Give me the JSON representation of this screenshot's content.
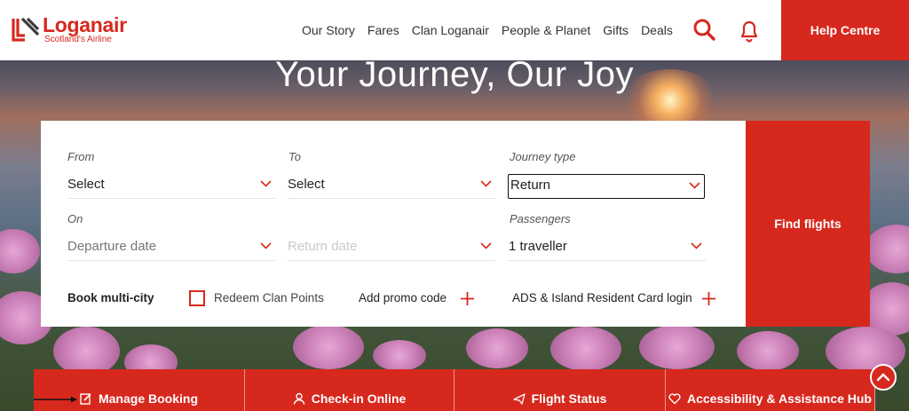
{
  "header": {
    "logo": {
      "name": "Loganair",
      "tagline": "Scotland's Airline"
    },
    "nav": [
      "Our Story",
      "Fares",
      "Clan Loganair",
      "People & Planet",
      "Gifts",
      "Deals"
    ],
    "help_label": "Help Centre"
  },
  "hero": {
    "title": "Your Journey, Our Joy"
  },
  "booking": {
    "from": {
      "label": "From",
      "value": "Select"
    },
    "to": {
      "label": "To",
      "value": "Select"
    },
    "journey_type": {
      "label": "Journey type",
      "value": "Return"
    },
    "on": {
      "label": "On",
      "departure_placeholder": "Departure date",
      "return_placeholder": "Return date"
    },
    "passengers": {
      "label": "Passengers",
      "value": "1 traveller"
    },
    "multi_city": "Book multi-city",
    "redeem": "Redeem Clan Points",
    "promo": "Add promo code",
    "ads": "ADS & Island Resident Card login",
    "find_flights": "Find flights"
  },
  "quick_links": [
    {
      "label": "Manage Booking",
      "icon": "edit-icon"
    },
    {
      "label": "Check-in Online",
      "icon": "person-icon"
    },
    {
      "label": "Flight Status",
      "icon": "plane-icon"
    },
    {
      "label": "Accessibility & Assistance Hub",
      "icon": "heart-icon"
    }
  ],
  "colors": {
    "brand_red": "#d7281e"
  }
}
